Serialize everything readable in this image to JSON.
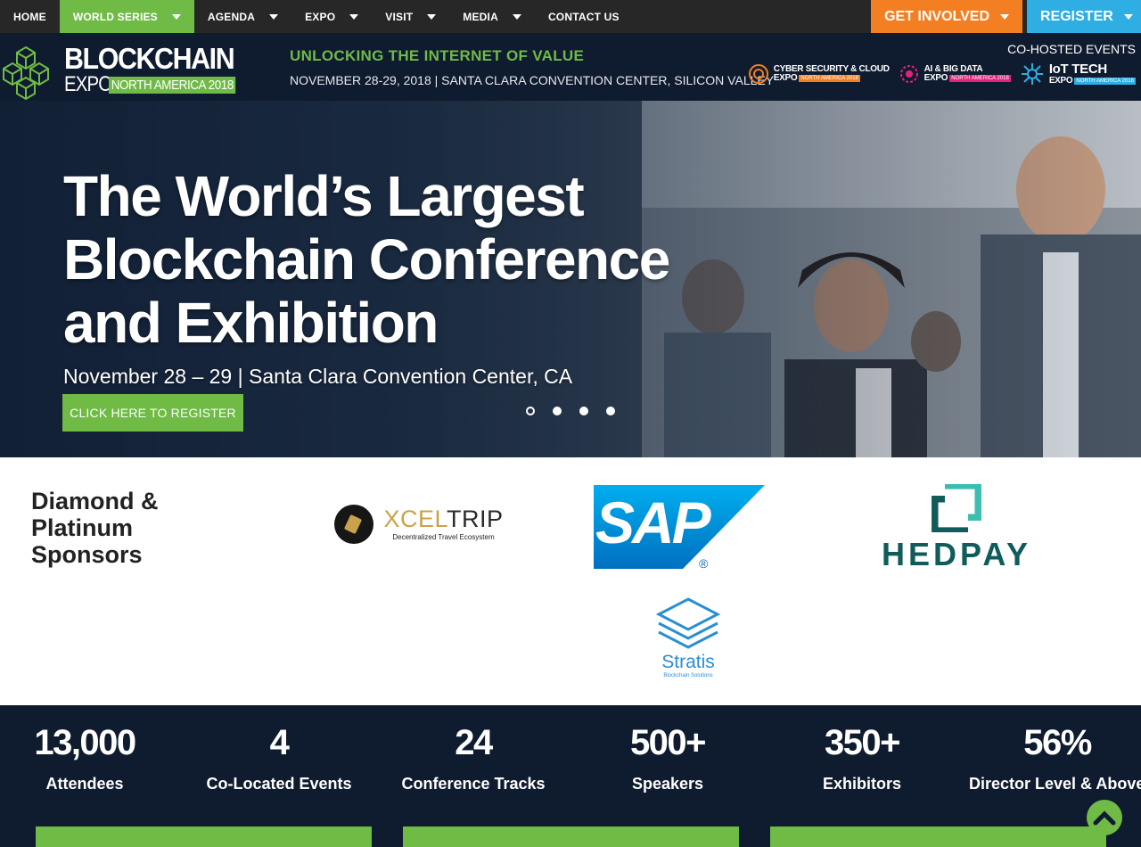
{
  "nav": {
    "items": [
      {
        "label": "HOME",
        "dropdown": false
      },
      {
        "label": "WORLD SERIES",
        "dropdown": true
      },
      {
        "label": "AGENDA",
        "dropdown": true
      },
      {
        "label": "EXPO",
        "dropdown": true
      },
      {
        "label": "VISIT",
        "dropdown": true
      },
      {
        "label": "MEDIA",
        "dropdown": true
      },
      {
        "label": "CONTACT US",
        "dropdown": false
      }
    ],
    "get_involved": "GET INVOLVED",
    "register": "REGISTER"
  },
  "header": {
    "logo_main": "BLOCKCHAIN",
    "logo_expo": "EXPO",
    "logo_region": "NORTH AMERICA 2018",
    "tagline_title": "UNLOCKING THE INTERNET OF VALUE",
    "tagline_sub": "NOVEMBER 28-29, 2018 | SANTA CLARA CONVENTION CENTER, SILICON VALLEY",
    "cohosted_label": "CO-HOSTED EVENTS",
    "cohosted": [
      {
        "name": "CYBER SECURITY & CLOUD",
        "expo": "EXPO",
        "badge": "NORTH AMERICA 2018",
        "color": "#f47f22"
      },
      {
        "name": "AI & BIG DATA",
        "expo": "EXPO",
        "badge": "NORTH AMERICA 2018",
        "color": "#e0247c"
      },
      {
        "name": "IoT TECH",
        "expo": "EXPO",
        "badge": "NORTH AMERICA 2018",
        "color": "#2faee4"
      }
    ]
  },
  "hero": {
    "title_line1": "The World’s Largest",
    "title_line2": "Blockchain Conference",
    "title_line3": "and Exhibition",
    "subtitle": "November 28 – 29  | Santa Clara Convention Center, CA",
    "cta": "CLICK HERE TO REGISTER",
    "slides": 4,
    "active_slide": 1
  },
  "sponsors": {
    "heading_line1": "Diamond &",
    "heading_line2": "Platinum",
    "heading_line3": "Sponsors",
    "xceltrip_name_1": "XCEL",
    "xceltrip_name_2": "TRIP",
    "xceltrip_tag": "Decentralized Travel Ecosystem",
    "sap_name": "SAP",
    "hedpay_name": "HEDPAY",
    "stratis_name": "Stratis",
    "stratis_tag": "Blockchain Solutions"
  },
  "stats": [
    {
      "value": "13,000",
      "label": "Attendees"
    },
    {
      "value": "4",
      "label": "Co-Located Events"
    },
    {
      "value": "24",
      "label": "Conference Tracks"
    },
    {
      "value": "500+",
      "label": "Speakers"
    },
    {
      "value": "350+",
      "label": "Exhibitors"
    },
    {
      "value": "56%",
      "label": "Director Level & Above"
    }
  ],
  "colors": {
    "green": "#6fbb46",
    "orange": "#f47f22",
    "blue": "#2faee4",
    "navy": "#0f1b2e",
    "dark_nav": "#272727"
  }
}
